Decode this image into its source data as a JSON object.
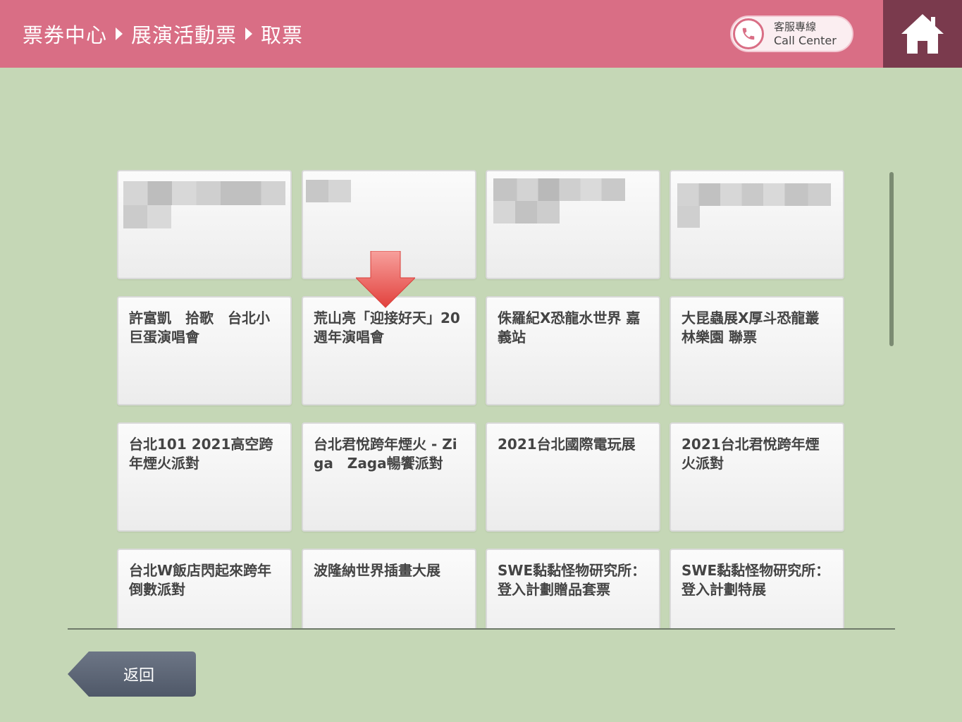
{
  "header": {
    "breadcrumb": [
      "票券中心",
      "展演活動票",
      "取票"
    ],
    "call_center_zh": "客服專線",
    "call_center_en": "Call Center",
    "home_icon": "home-icon"
  },
  "tiles": [
    {
      "title": ""
    },
    {
      "title": ""
    },
    {
      "title": ""
    },
    {
      "title": ""
    },
    {
      "title": "許富凱　拾歌　台北小巨蛋演唱會"
    },
    {
      "title": "荒山亮「迎接好天」20週年演唱會"
    },
    {
      "title": "侏羅紀X恐龍水世界 嘉義站"
    },
    {
      "title": "大昆蟲展X厚斗恐龍叢林樂園 聯票"
    },
    {
      "title": "台北101 2021高空跨年煙火派對"
    },
    {
      "title": "台北君悅跨年煙火 - Ziga　Zaga暢饗派對"
    },
    {
      "title": "2021台北國際電玩展"
    },
    {
      "title": "2021台北君悅跨年煙火派對"
    },
    {
      "title": "台北W飯店閃起來跨年倒數派對"
    },
    {
      "title": "波隆納世界插畫大展"
    },
    {
      "title": "SWE黏黏怪物研究所：登入計劃贈品套票"
    },
    {
      "title": "SWE黏黏怪物研究所：登入計劃特展"
    }
  ],
  "back_button": "返回",
  "colors": {
    "header": "#d96e85",
    "home": "#7a3a4d",
    "background": "#c5d7b6",
    "back_button": "#5d6677",
    "arrow": "#e8524f"
  }
}
